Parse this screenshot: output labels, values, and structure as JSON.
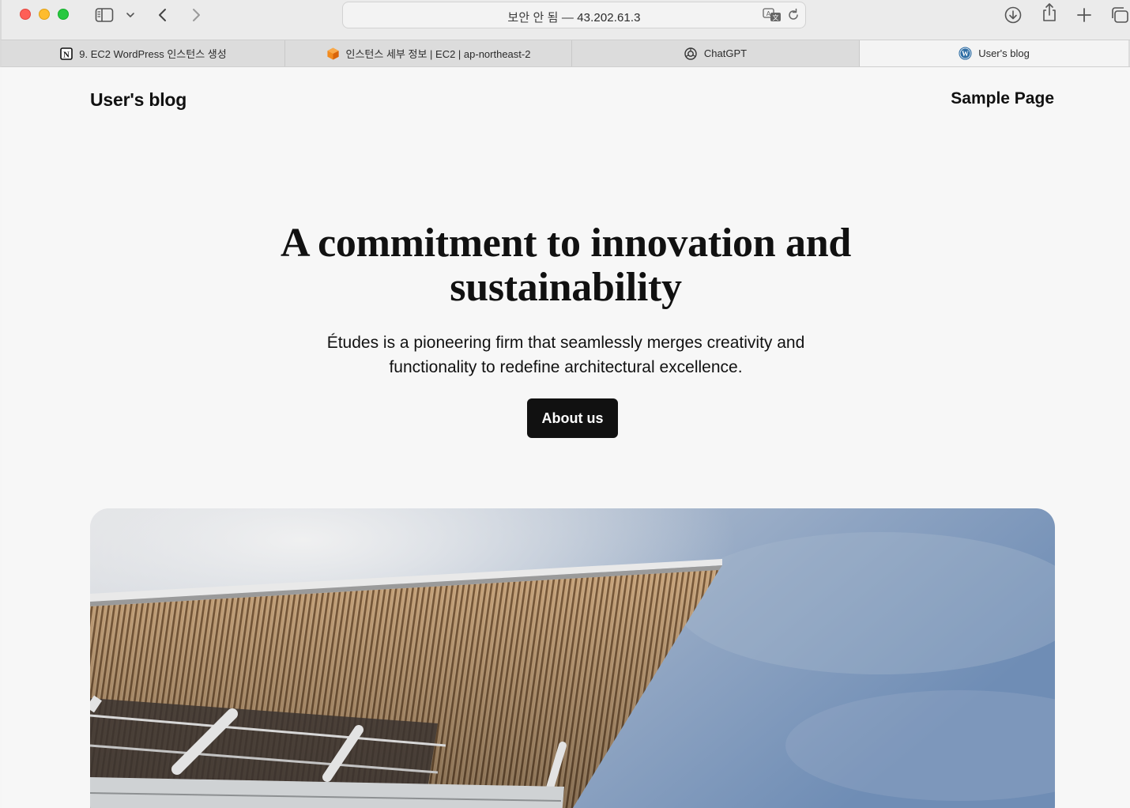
{
  "browser": {
    "address_security": "보안 안 됨 —",
    "address_host": "43.202.61.3",
    "tabs": [
      {
        "label": "9. EC2 WordPress 인스턴스 생성",
        "icon": "notion-icon",
        "active": false
      },
      {
        "label": "인스턴스 세부 정보 | EC2 | ap-northeast-2",
        "icon": "aws-cube-icon",
        "active": false
      },
      {
        "label": "ChatGPT",
        "icon": "chatgpt-icon",
        "active": false
      },
      {
        "label": "User's blog",
        "icon": "wordpress-icon",
        "active": true
      }
    ],
    "colors": {
      "close": "#fe5f57",
      "minimize": "#febc2e",
      "maximize": "#28c840"
    }
  },
  "site": {
    "title": "User's blog",
    "nav": {
      "sample_page": "Sample Page"
    }
  },
  "hero": {
    "title_line1": "A commitment to innovation and",
    "title_line2": "sustainability",
    "desc_line1": "Études is a pioneering firm that seamlessly merges creativity and",
    "desc_line2": "functionality to redefine architectural excellence.",
    "button_label": "About us"
  }
}
